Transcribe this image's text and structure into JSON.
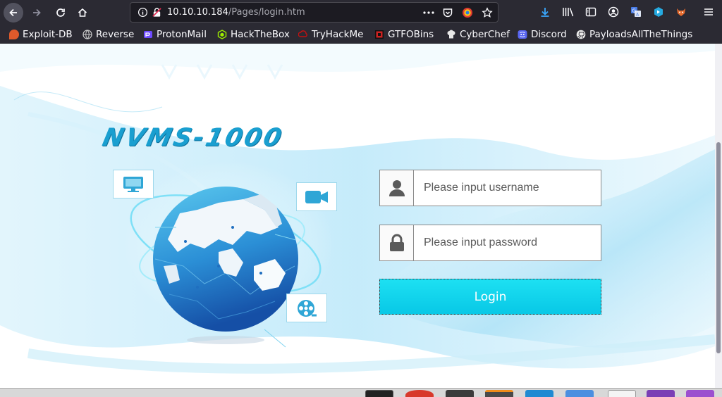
{
  "browser": {
    "url_host": "10.10.10.184",
    "url_path": "/Pages/login.htm",
    "colors": {
      "chrome_bg": "#2b2a33",
      "url_bg": "#1c1b22"
    }
  },
  "bookmarks": [
    {
      "label": "Exploit-DB",
      "icon": "exploit-db-icon",
      "color": "#e05a2b"
    },
    {
      "label": "Reverse",
      "icon": "globe-icon",
      "color": "#d0d0d0"
    },
    {
      "label": "ProtonMail",
      "icon": "protonmail-icon",
      "color": "#6d4aff"
    },
    {
      "label": "HackTheBox",
      "icon": "hackthebox-icon",
      "color": "#9fef00"
    },
    {
      "label": "TryHackMe",
      "icon": "tryhackme-icon",
      "color": "#c11111"
    },
    {
      "label": "GTFOBins",
      "icon": "gtfobins-icon",
      "color": "#cc2222"
    },
    {
      "label": "CyberChef",
      "icon": "cyberchef-icon",
      "color": "#e8e8e8"
    },
    {
      "label": "Discord",
      "icon": "discord-icon",
      "color": "#5865f2"
    },
    {
      "label": "PayloadsAllTheThings",
      "icon": "github-icon",
      "color": "#e8e8e8"
    }
  ],
  "page": {
    "logo_text": "NVMS-1000",
    "username": {
      "placeholder": "Please input username",
      "value": ""
    },
    "password": {
      "placeholder": "Please input password",
      "value": ""
    },
    "login_label": "Login",
    "colors": {
      "accent": "#0ccde8",
      "logo": "#1a9fd0",
      "globe_dark": "#1b63b8",
      "globe_light": "#38b6e6"
    }
  }
}
